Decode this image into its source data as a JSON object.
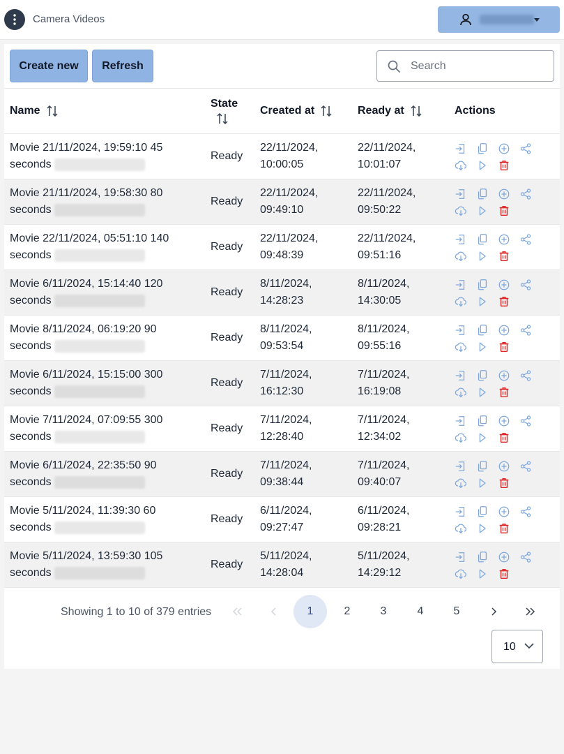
{
  "app": {
    "title": "Camera Videos"
  },
  "toolbar": {
    "create_label": "Create new",
    "refresh_label": "Refresh",
    "search_placeholder": "Search",
    "search_value": ""
  },
  "table": {
    "headers": {
      "name": "Name",
      "state": "State",
      "created": "Created at",
      "ready": "Ready at",
      "actions": "Actions"
    },
    "rows": [
      {
        "name": "Movie 21/11/2024, 19:59:10 45",
        "name2": "seconds",
        "state": "Ready",
        "created1": "22/11/2024,",
        "created2": "10:00:05",
        "ready1": "22/11/2024,",
        "ready2": "10:01:07"
      },
      {
        "name": "Movie 21/11/2024, 19:58:30 80",
        "name2": "seconds",
        "state": "Ready",
        "created1": "22/11/2024,",
        "created2": "09:49:10",
        "ready1": "22/11/2024,",
        "ready2": "09:50:22"
      },
      {
        "name": "Movie 22/11/2024, 05:51:10 140",
        "name2": "seconds",
        "state": "Ready",
        "created1": "22/11/2024,",
        "created2": "09:48:39",
        "ready1": "22/11/2024,",
        "ready2": "09:51:16"
      },
      {
        "name": "Movie 6/11/2024, 15:14:40 120",
        "name2": "seconds",
        "state": "Ready",
        "created1": "8/11/2024,",
        "created2": "14:28:23",
        "ready1": "8/11/2024,",
        "ready2": "14:30:05"
      },
      {
        "name": "Movie 8/11/2024, 06:19:20 90",
        "name2": "seconds",
        "state": "Ready",
        "created1": "8/11/2024,",
        "created2": "09:53:54",
        "ready1": "8/11/2024,",
        "ready2": "09:55:16"
      },
      {
        "name": "Movie 6/11/2024, 15:15:00 300",
        "name2": "seconds",
        "state": "Ready",
        "created1": "7/11/2024,",
        "created2": "16:12:30",
        "ready1": "7/11/2024,",
        "ready2": "16:19:08"
      },
      {
        "name": "Movie 7/11/2024, 07:09:55 300",
        "name2": "seconds",
        "state": "Ready",
        "created1": "7/11/2024,",
        "created2": "12:28:40",
        "ready1": "7/11/2024,",
        "ready2": "12:34:02"
      },
      {
        "name": "Movie 6/11/2024, 22:35:50 90",
        "name2": "seconds",
        "state": "Ready",
        "created1": "7/11/2024,",
        "created2": "09:38:44",
        "ready1": "7/11/2024,",
        "ready2": "09:40:07"
      },
      {
        "name": "Movie 5/11/2024, 11:39:30 60",
        "name2": "seconds",
        "state": "Ready",
        "created1": "6/11/2024,",
        "created2": "09:27:47",
        "ready1": "6/11/2024,",
        "ready2": "09:28:21"
      },
      {
        "name": "Movie 5/11/2024, 13:59:30 105",
        "name2": "seconds",
        "state": "Ready",
        "created1": "5/11/2024,",
        "created2": "14:28:04",
        "ready1": "5/11/2024,",
        "ready2": "14:29:12"
      }
    ]
  },
  "pagination": {
    "showing": "Showing 1 to 10 of 379 entries",
    "pages": [
      "1",
      "2",
      "3",
      "4",
      "5"
    ],
    "active_page": "1",
    "page_size": "10"
  },
  "icons": {
    "menu": "vertical-dots-icon",
    "user": "user-icon",
    "search": "search-icon",
    "sort": "sort-icon",
    "row_actions": [
      "import-icon",
      "copy-icon",
      "add-icon",
      "share-icon",
      "download-icon",
      "play-icon",
      "delete-icon"
    ]
  },
  "colors": {
    "accent": "#8fb3e2",
    "action_icon": "#7da7dc",
    "delete_icon": "#dc2626",
    "topbar": "#ffffff",
    "background": "#f4f4f5"
  }
}
